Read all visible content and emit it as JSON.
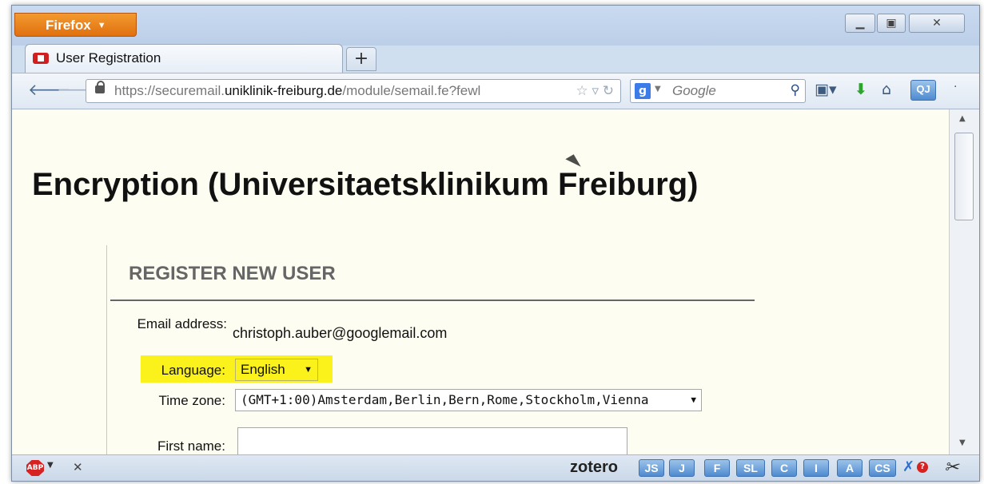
{
  "browser": {
    "app_button": "Firefox",
    "tab_title": "User Registration",
    "url": {
      "prefix": "https://securemail.",
      "domain": "uniklinik-freiburg.de",
      "path": "/module/semail.fe?fewl"
    },
    "search_placeholder": "Google",
    "toolbar_qj": "QJ"
  },
  "page": {
    "heading": "Encryption (Universitaetsklinikum Freiburg)",
    "panel_title": "REGISTER NEW USER",
    "fields": {
      "email_label": "Email address:",
      "email_value": "christoph.auber@googlemail.com",
      "language_label": "Language:",
      "language_value": "English",
      "timezone_label": "Time zone:",
      "timezone_value": "(GMT+1:00)Amsterdam,Berlin,Bern,Rome,Stockholm,Vienna",
      "firstname_label": "First name:"
    }
  },
  "statusbar": {
    "abp": "ABP",
    "zotero": "zotero",
    "buttons": [
      "JS",
      "J",
      "F",
      "SL",
      "C",
      "I",
      "A",
      "CS"
    ]
  },
  "colors": {
    "highlight": "#fbf21c",
    "content_bg": "#fdfdf2",
    "firefox_orange": "#e07010"
  }
}
